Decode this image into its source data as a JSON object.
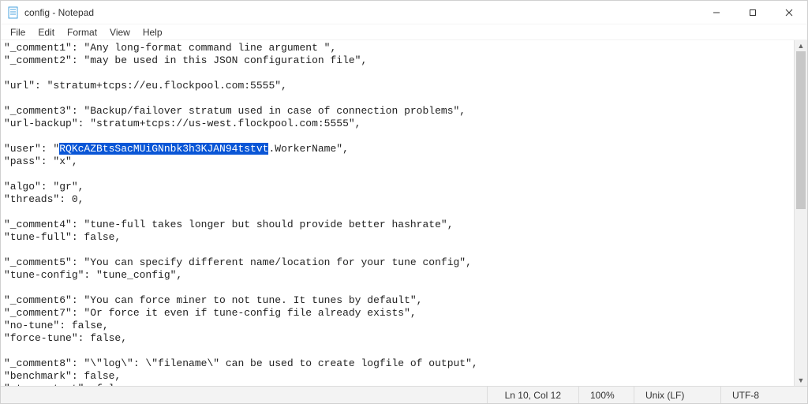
{
  "window": {
    "title": "config - Notepad"
  },
  "menu": {
    "file": "File",
    "edit": "Edit",
    "format": "Format",
    "view": "View",
    "help": "Help"
  },
  "editor": {
    "lines": [
      "\"_comment1\": \"Any long-format command line argument \",",
      "\"_comment2\": \"may be used in this JSON configuration file\",",
      "",
      "\"url\": \"stratum+tcps://eu.flockpool.com:5555\",",
      "",
      "\"_comment3\": \"Backup/failover stratum used in case of connection problems\",",
      "\"url-backup\": \"stratum+tcps://us-west.flockpool.com:5555\",",
      "",
      "",
      "\"pass\": \"x\",",
      "",
      "\"algo\": \"gr\",",
      "\"threads\": 0,",
      "",
      "\"_comment4\": \"tune-full takes longer but should provide better hashrate\",",
      "\"tune-full\": false,",
      "",
      "\"_comment5\": \"You can specify different name/location for your tune config\",",
      "\"tune-config\": \"tune_config\",",
      "",
      "\"_comment6\": \"You can force miner to not tune. It tunes by default\",",
      "\"_comment7\": \"Or force it even if tune-config file already exists\",",
      "\"no-tune\": false,",
      "\"force-tune\": false,",
      "",
      "\"_comment8\": \"\\\"log\\\": \\\"filename\\\" can be used to create logfile of output\",",
      "\"benchmark\": false,",
      "\"stress-test\": false,"
    ],
    "user_line": {
      "prefix": "\"user\": \"",
      "selected": "RQKcAZBtsSacMUiGNnbk3h3KJAN94tstvt",
      "suffix": ".WorkerName\","
    }
  },
  "status": {
    "position": "Ln 10, Col 12",
    "zoom": "100%",
    "line_ending": "Unix (LF)",
    "encoding": "UTF-8"
  }
}
